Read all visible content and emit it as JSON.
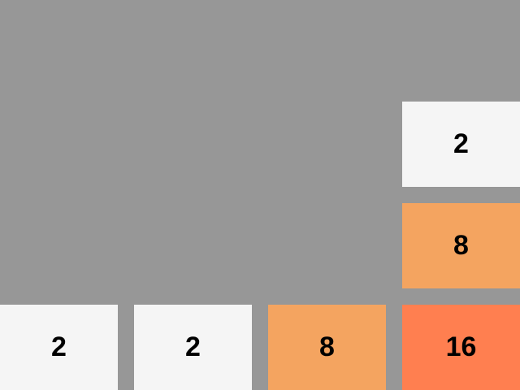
{
  "game": {
    "colors": {
      "background": "#979797",
      "tile_2": "#f5f5f5",
      "tile_8": "#f4a460",
      "tile_16": "#ff7f50",
      "text": "#000000"
    },
    "grid": [
      [
        null,
        null,
        null,
        null
      ],
      [
        null,
        null,
        null,
        "2"
      ],
      [
        null,
        null,
        null,
        "8"
      ],
      [
        "2",
        "2",
        "8",
        "16"
      ]
    ]
  }
}
